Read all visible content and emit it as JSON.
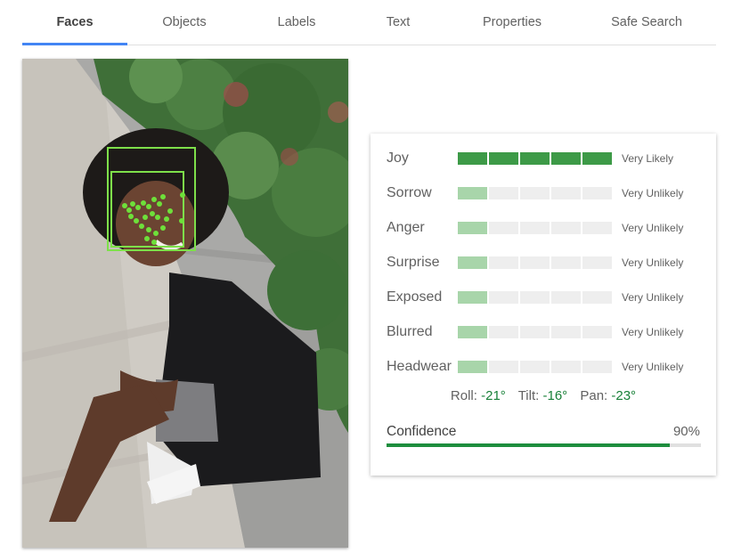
{
  "tabs": [
    {
      "label": "Faces",
      "active": true
    },
    {
      "label": "Objects",
      "active": false
    },
    {
      "label": "Labels",
      "active": false
    },
    {
      "label": "Text",
      "active": false
    },
    {
      "label": "Properties",
      "active": false
    },
    {
      "label": "Safe Search",
      "active": false
    }
  ],
  "colors": {
    "accent": "#4285f4",
    "bar_strong": "#3d9a47",
    "bar_weak": "#a8d5aa",
    "bar_empty": "#eeeeee",
    "angle_value": "#188038",
    "confidence": "#1e8e3e",
    "face_box": "#7ee04a"
  },
  "emotions": [
    {
      "label": "Joy",
      "likelihood": "Very Likely",
      "level": 5
    },
    {
      "label": "Sorrow",
      "likelihood": "Very Unlikely",
      "level": 1
    },
    {
      "label": "Anger",
      "likelihood": "Very Unlikely",
      "level": 1
    },
    {
      "label": "Surprise",
      "likelihood": "Very Unlikely",
      "level": 1
    },
    {
      "label": "Exposed",
      "likelihood": "Very Unlikely",
      "level": 1
    },
    {
      "label": "Blurred",
      "likelihood": "Very Unlikely",
      "level": 1
    },
    {
      "label": "Headwear",
      "likelihood": "Very Unlikely",
      "level": 1
    }
  ],
  "angles": {
    "roll_label": "Roll:",
    "roll": "-21°",
    "tilt_label": "Tilt:",
    "tilt": "-16°",
    "pan_label": "Pan:",
    "pan": "-23°"
  },
  "confidence": {
    "label": "Confidence",
    "value": "90%",
    "percent": 90
  }
}
